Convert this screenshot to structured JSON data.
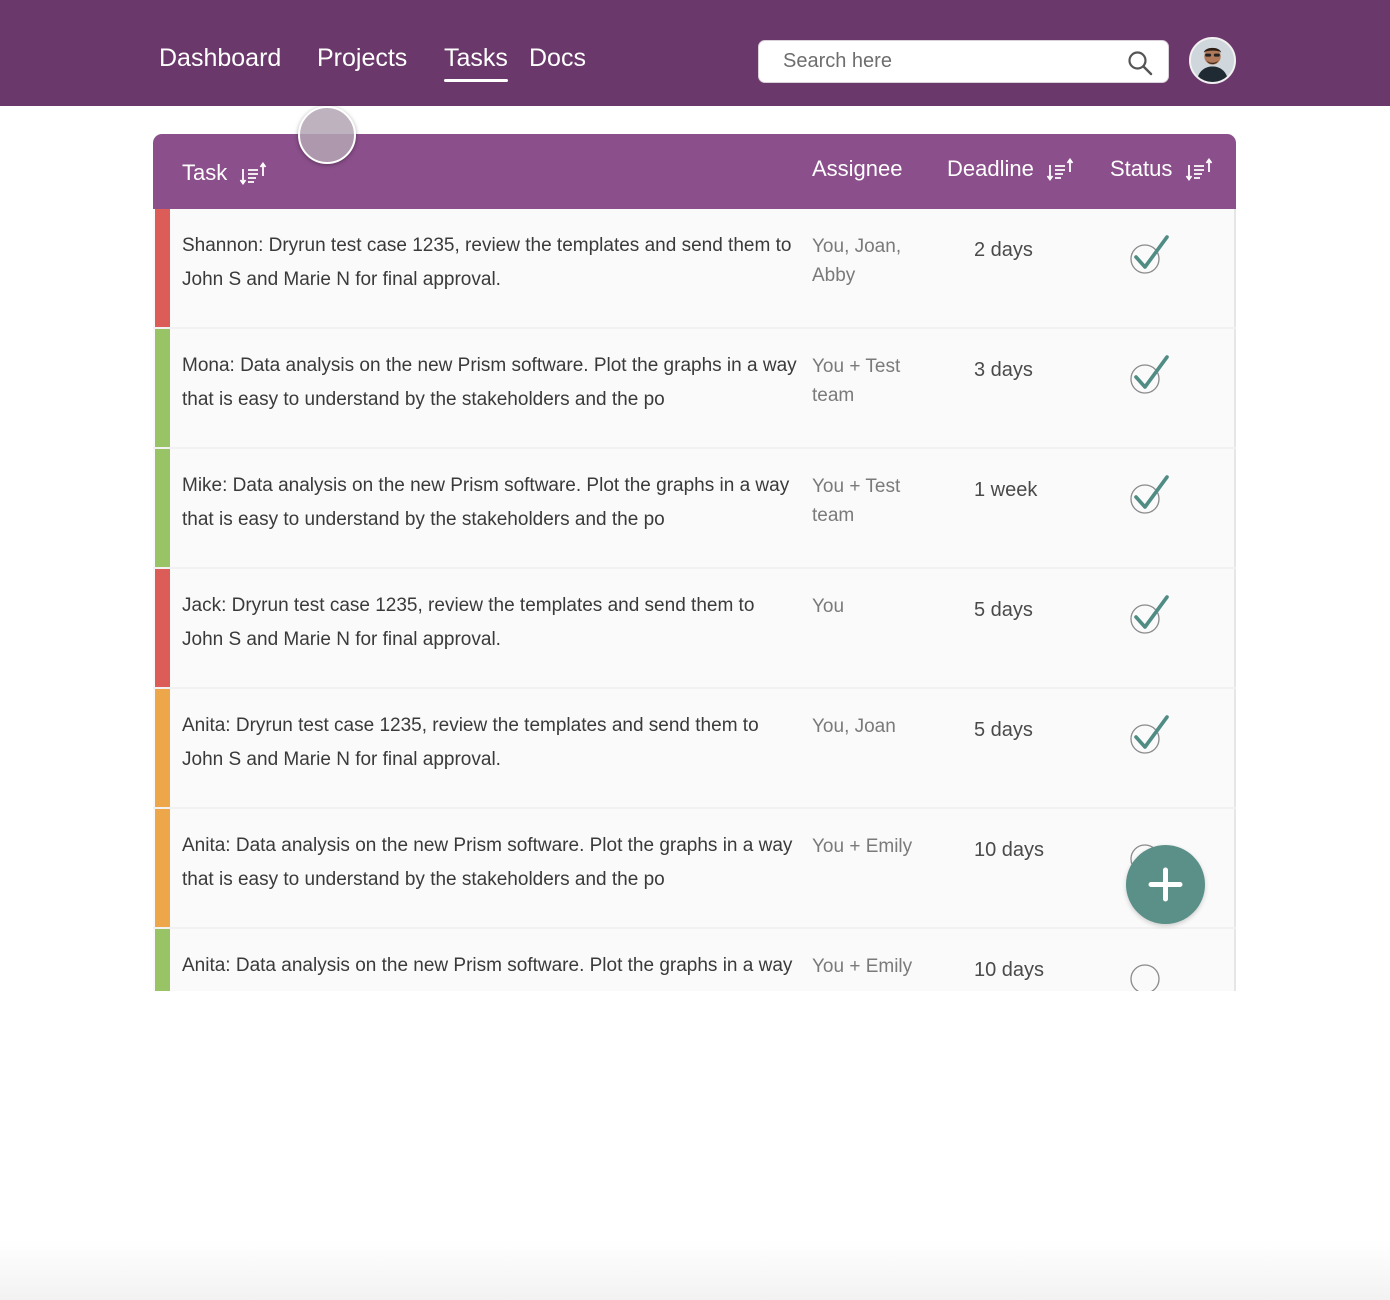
{
  "nav": {
    "items": [
      {
        "label": "Dashboard",
        "active": false
      },
      {
        "label": "Projects",
        "active": false
      },
      {
        "label": "Tasks",
        "active": true
      },
      {
        "label": "Docs",
        "active": false
      }
    ]
  },
  "search": {
    "placeholder": "Search here",
    "value": "",
    "icon": "search-icon"
  },
  "header_color": "#6b386b",
  "table": {
    "header_color": "#8b4f8b",
    "columns": [
      {
        "label": "Task",
        "sortable": true
      },
      {
        "label": "Assignee",
        "sortable": false
      },
      {
        "label": "Deadline",
        "sortable": true
      },
      {
        "label": "Status",
        "sortable": true
      }
    ],
    "rows": [
      {
        "color": "#dc5c58",
        "task": "Shannon: Dryrun test case 1235, review the templates and send them to John S and Marie N for final approval.",
        "assignee": "You, Joan, Abby",
        "deadline": "2 days",
        "done": true
      },
      {
        "color": "#98c465",
        "task": "Mona: Data analysis on the new Prism software. Plot the graphs in a way that is easy to understand by the stakeholders and the po",
        "assignee": "You + Test team",
        "deadline": "3 days",
        "done": true
      },
      {
        "color": "#98c465",
        "task": "Mike: Data analysis on the new Prism software. Plot the graphs in a way that is easy to understand by the stakeholders and the po",
        "assignee": "You + Test team",
        "deadline": "1 week",
        "done": true
      },
      {
        "color": "#dc5c58",
        "task": "Jack: Dryrun test case 1235, review the templates and send them to John S and Marie N for final approval.",
        "assignee": "You",
        "deadline": "5 days",
        "done": true
      },
      {
        "color": "#eea64a",
        "task": "Anita: Dryrun test case 1235, review the templates and send them to John S and Marie N for final approval.",
        "assignee": "You, Joan",
        "deadline": "5 days",
        "done": true
      },
      {
        "color": "#eea64a",
        "task": "Anita: Data analysis on the new Prism software. Plot the graphs in a way that is easy to understand by the stakeholders and the po",
        "assignee": "You + Emily",
        "deadline": "10 days",
        "done": false
      },
      {
        "color": "#98c465",
        "task": "Anita: Data analysis on the new Prism software. Plot the graphs in a way that is easy to understand by the stakeholders and the po",
        "assignee": "You + Emily",
        "deadline": "10 days",
        "done": false
      }
    ]
  },
  "fab": {
    "icon": "plus-icon",
    "color": "#5a9088"
  },
  "status_check_color": "#4f8c84"
}
